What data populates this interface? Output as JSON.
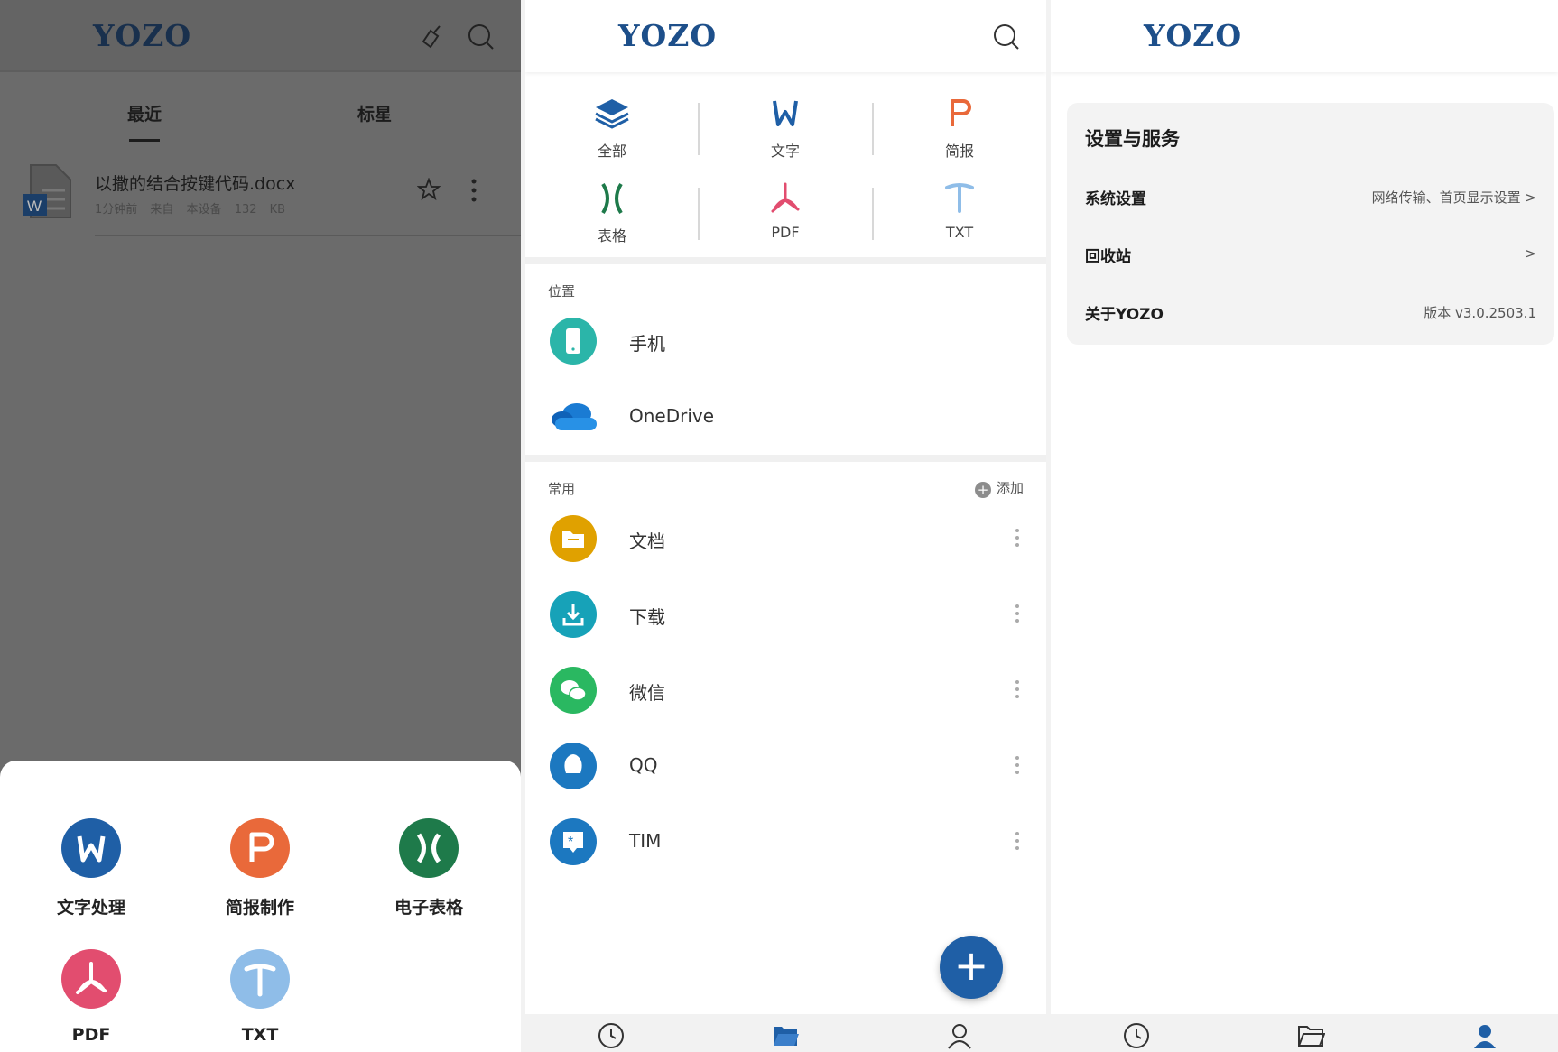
{
  "logo": "YOZO",
  "screen1": {
    "tabs": [
      "最近",
      "标星"
    ],
    "file": {
      "name": "以撒的结合按键代码.docx",
      "time": "1分钟前",
      "source": "来自 本设备",
      "size": "132 KB"
    },
    "create": [
      {
        "label": "文字处理",
        "color": "#1f5fa6",
        "icon": "word-icon"
      },
      {
        "label": "简报制作",
        "color": "#e9693a",
        "icon": "presentation-icon"
      },
      {
        "label": "电子表格",
        "color": "#1e7a4a",
        "icon": "spreadsheet-icon"
      },
      {
        "label": "PDF",
        "color": "#e24d6f",
        "icon": "pdf-icon"
      },
      {
        "label": "TXT",
        "color": "#8fbde8",
        "icon": "txt-icon"
      }
    ]
  },
  "screen2": {
    "categories": [
      {
        "label": "全部",
        "icon": "layers-icon"
      },
      {
        "label": "文字",
        "icon": "word-icon"
      },
      {
        "label": "简报",
        "icon": "presentation-icon"
      },
      {
        "label": "表格",
        "icon": "spreadsheet-icon"
      },
      {
        "label": "PDF",
        "icon": "pdf-icon"
      },
      {
        "label": "TXT",
        "icon": "txt-icon"
      }
    ],
    "location_title": "位置",
    "locations": [
      {
        "label": "手机",
        "icon": "phone-icon"
      },
      {
        "label": "OneDrive",
        "icon": "onedrive-icon"
      }
    ],
    "common_title": "常用",
    "add_label": "添加",
    "common": [
      {
        "label": "文档",
        "icon": "folder-icon",
        "color": "#e0a100"
      },
      {
        "label": "下载",
        "icon": "download-icon",
        "color": "#17a2b8"
      },
      {
        "label": "微信",
        "icon": "wechat-icon",
        "color": "#2ab861"
      },
      {
        "label": "QQ",
        "icon": "qq-icon",
        "color": "#1c78c0"
      },
      {
        "label": "TIM",
        "icon": "tim-icon",
        "color": "#1c78c0"
      }
    ]
  },
  "screen3": {
    "card_title": "设置与服务",
    "rows": [
      {
        "label": "系统设置",
        "value": "网络传输、首页显示设置 >"
      },
      {
        "label": "回收站",
        "value": ">"
      },
      {
        "label": "关于YOZO",
        "value": "版本 v3.0.2503.1"
      }
    ]
  },
  "nav": [
    "recent-icon",
    "folder-icon",
    "profile-icon"
  ],
  "colors": {
    "brand": "#1f5fa6",
    "overlay": "#6b6b6b"
  }
}
